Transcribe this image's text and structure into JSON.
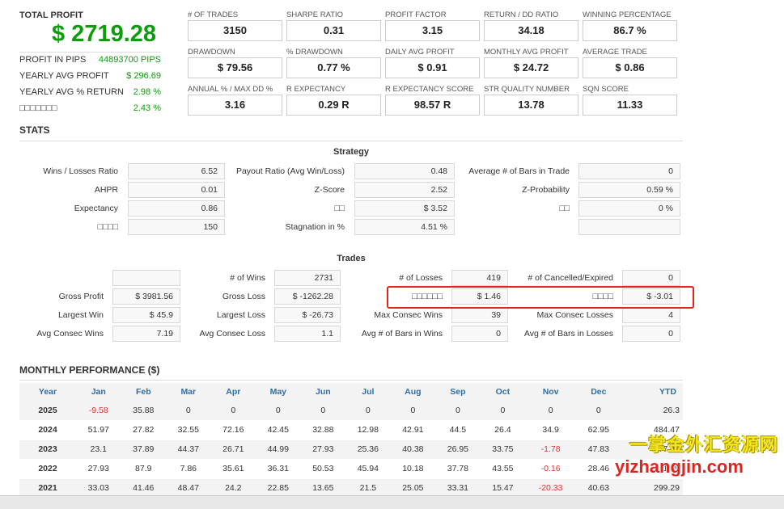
{
  "summary": {
    "total_profit_label": "TOTAL PROFIT",
    "total_profit_value": "$ 2719.28",
    "rows": [
      {
        "label": "PROFIT IN PIPS",
        "value": "44893700 PIPS"
      },
      {
        "label": "YEARLY AVG PROFIT",
        "value": "$ 296.69"
      },
      {
        "label": "YEARLY AVG % RETURN",
        "value": "2.98 %"
      },
      {
        "label": "□□□□□□□",
        "value": "2.43 %"
      }
    ]
  },
  "metrics": [
    {
      "label": "# OF TRADES",
      "value": "3150"
    },
    {
      "label": "SHARPE RATIO",
      "value": "0.31"
    },
    {
      "label": "PROFIT FACTOR",
      "value": "3.15"
    },
    {
      "label": "RETURN / DD RATIO",
      "value": "34.18"
    },
    {
      "label": "WINNING PERCENTAGE",
      "value": "86.7 %"
    },
    {
      "label": "DRAWDOWN",
      "value": "$ 79.56"
    },
    {
      "label": "% DRAWDOWN",
      "value": "0.77 %"
    },
    {
      "label": "DAILY AVG PROFIT",
      "value": "$ 0.91"
    },
    {
      "label": "MONTHLY AVG PROFIT",
      "value": "$ 24.72"
    },
    {
      "label": "AVERAGE TRADE",
      "value": "$ 0.86"
    },
    {
      "label": "ANNUAL % / MAX DD %",
      "value": "3.16"
    },
    {
      "label": "R EXPECTANCY",
      "value": "0.29 R"
    },
    {
      "label": "R EXPECTANCY SCORE",
      "value": "98.57 R"
    },
    {
      "label": "STR QUALITY NUMBER",
      "value": "13.78"
    },
    {
      "label": "SQN SCORE",
      "value": "11.33"
    }
  ],
  "stats": {
    "title": "STATS",
    "strategy_title": "Strategy",
    "strategy": [
      {
        "label": "Wins / Losses Ratio",
        "value": "6.52"
      },
      {
        "label": "Payout Ratio (Avg Win/Loss)",
        "value": "0.48"
      },
      {
        "label": "Average # of Bars in Trade",
        "value": "0"
      },
      {
        "label": "AHPR",
        "value": "0.01"
      },
      {
        "label": "Z-Score",
        "value": "2.52"
      },
      {
        "label": "Z-Probability",
        "value": "0.59 %"
      },
      {
        "label": "Expectancy",
        "value": "0.86"
      },
      {
        "label": "□□",
        "value": "$ 3.52"
      },
      {
        "label": "□□",
        "value": "0 %"
      },
      {
        "label": "□□□□",
        "value": "150"
      },
      {
        "label": "Stagnation in %",
        "value": "4.51 %"
      },
      {
        "label": "",
        "value": ""
      }
    ],
    "trades_title": "Trades",
    "trades": [
      {
        "label": "",
        "value": ""
      },
      {
        "label": "# of Wins",
        "value": "2731"
      },
      {
        "label": "# of Losses",
        "value": "419"
      },
      {
        "label": "# of Cancelled/Expired",
        "value": "0"
      },
      {
        "label": "Gross Profit",
        "value": "$ 3981.56"
      },
      {
        "label": "Gross Loss",
        "value": "$ -1262.28"
      },
      {
        "label": "□□□□□□",
        "value": "$ 1.46"
      },
      {
        "label": "□□□□",
        "value": "$ -3.01"
      },
      {
        "label": "Largest Win",
        "value": "$ 45.9"
      },
      {
        "label": "Largest Loss",
        "value": "$ -26.73"
      },
      {
        "label": "Max Consec Wins",
        "value": "39"
      },
      {
        "label": "Max Consec Losses",
        "value": "4"
      },
      {
        "label": "Avg Consec Wins",
        "value": "7.19"
      },
      {
        "label": "Avg Consec Loss",
        "value": "1.1"
      },
      {
        "label": "Avg # of Bars in Wins",
        "value": "0"
      },
      {
        "label": "Avg # of Bars in Losses",
        "value": "0"
      }
    ]
  },
  "monthly": {
    "title": "MONTHLY PERFORMANCE ($)",
    "headers": [
      "Year",
      "Jan",
      "Feb",
      "Mar",
      "Apr",
      "May",
      "Jun",
      "Jul",
      "Aug",
      "Sep",
      "Oct",
      "Nov",
      "Dec",
      "YTD"
    ],
    "rows": [
      [
        "2025",
        "-9.58",
        "35.88",
        "0",
        "0",
        "0",
        "0",
        "0",
        "0",
        "0",
        "0",
        "0",
        "0",
        "26.3"
      ],
      [
        "2024",
        "51.97",
        "27.82",
        "32.55",
        "72.16",
        "42.45",
        "32.88",
        "12.98",
        "42.91",
        "44.5",
        "26.4",
        "34.9",
        "62.95",
        "484.47"
      ],
      [
        "2023",
        "23.1",
        "37.89",
        "44.37",
        "26.71",
        "44.99",
        "27.93",
        "25.36",
        "40.38",
        "26.95",
        "33.75",
        "-1.78",
        "47.83",
        "377.48"
      ],
      [
        "2022",
        "27.93",
        "87.9",
        "7.86",
        "35.61",
        "36.31",
        "50.53",
        "45.94",
        "10.18",
        "37.78",
        "43.55",
        "-0.16",
        "28.46",
        "411.89"
      ],
      [
        "2021",
        "33.03",
        "41.46",
        "48.47",
        "24.2",
        "22.85",
        "13.65",
        "21.5",
        "25.05",
        "33.31",
        "15.47",
        "-20.33",
        "40.63",
        "299.29"
      ]
    ]
  },
  "watermark": {
    "line1": "一掌金外汇资源网",
    "line2": "yizhangjin.com"
  },
  "colors": {
    "profit_green": "#0e9c0e",
    "negative_red": "#e03232",
    "header_blue": "#2e6fa8",
    "highlight_red": "#e8231e"
  }
}
